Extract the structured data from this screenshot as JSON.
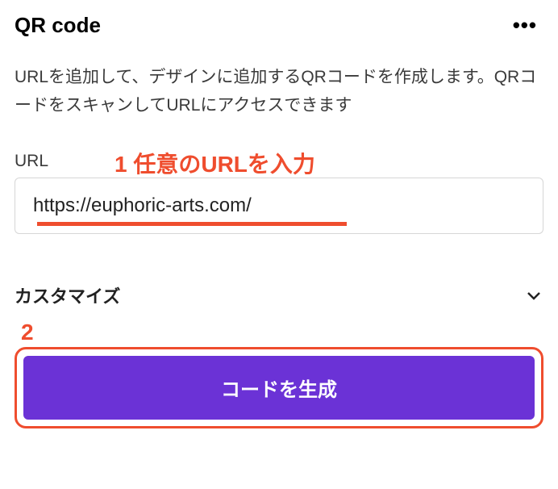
{
  "header": {
    "title": "QR code"
  },
  "description": "URLを追加して、デザインに追加するQRコードを作成します。QRコードをスキャンしてURLにアクセスできます",
  "urlField": {
    "label": "URL",
    "value": "https://euphoric-arts.com/"
  },
  "annotations": {
    "step1": "1 任意のURLを入力",
    "step2": "2"
  },
  "customize": {
    "label": "カスタマイズ"
  },
  "generate": {
    "label": "コードを生成"
  },
  "colors": {
    "accent": "#ef4d2e",
    "primary": "#6b32d6"
  }
}
